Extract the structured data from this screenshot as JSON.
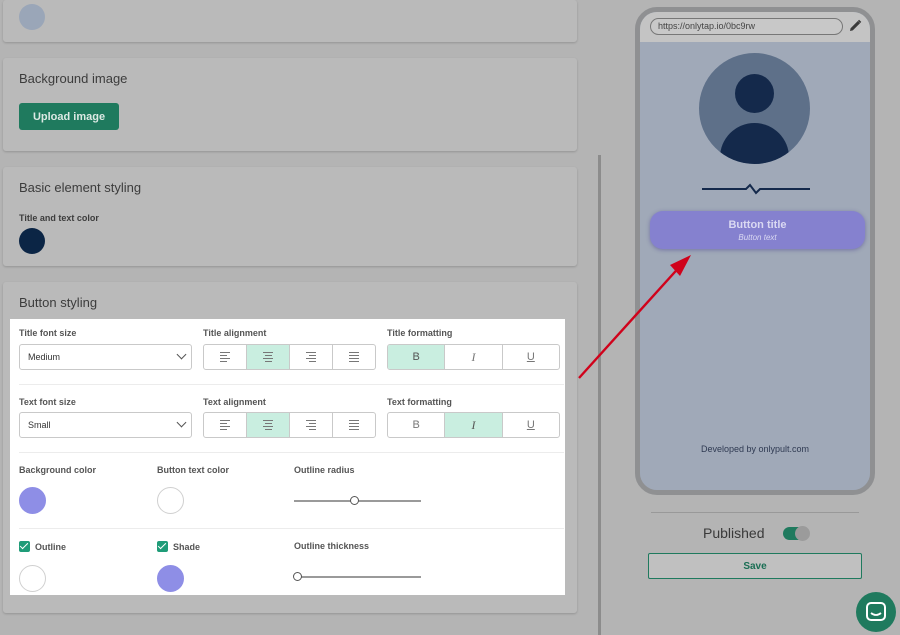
{
  "editor": {
    "background_image": {
      "title": "Background image",
      "upload_label": "Upload image"
    },
    "basic_styling": {
      "title": "Basic element styling",
      "title_text_color_label": "Title and text color",
      "title_text_color": "#0b2545"
    },
    "button_styling": {
      "title": "Button styling",
      "title_font_size_label": "Title font size",
      "title_font_size": "Medium",
      "title_alignment_label": "Title alignment",
      "title_formatting_label": "Title formatting",
      "text_font_size_label": "Text font size",
      "text_font_size": "Small",
      "text_alignment_label": "Text alignment",
      "text_formatting_label": "Text formatting",
      "bold_glyph": "B",
      "italic_glyph": "I",
      "underline_glyph": "U",
      "background_color_label": "Background color",
      "background_color": "#8e8ee6",
      "button_text_color_label": "Button text color",
      "button_text_color": "#ffffff",
      "outline_radius_label": "Outline radius",
      "outline_radius_value": 0.48,
      "outline_label": "Outline",
      "outline_color": "#ffffff",
      "shade_label": "Shade",
      "shade_color": "#8e8ee6",
      "outline_thickness_label": "Outline thickness",
      "outline_thickness_value": 0.03
    }
  },
  "preview": {
    "url": "https://onlytap.io/0bc9rw",
    "button_title": "Button title",
    "button_text": "Button text",
    "developed_by": "Developed by onlypult.com"
  },
  "publish": {
    "published_label": "Published",
    "published_on": true,
    "save_label": "Save"
  },
  "colors": {
    "accent": "#1f7a5e",
    "active_toggle": "#c9eee0",
    "annotation_arrow": "#d0021b"
  }
}
